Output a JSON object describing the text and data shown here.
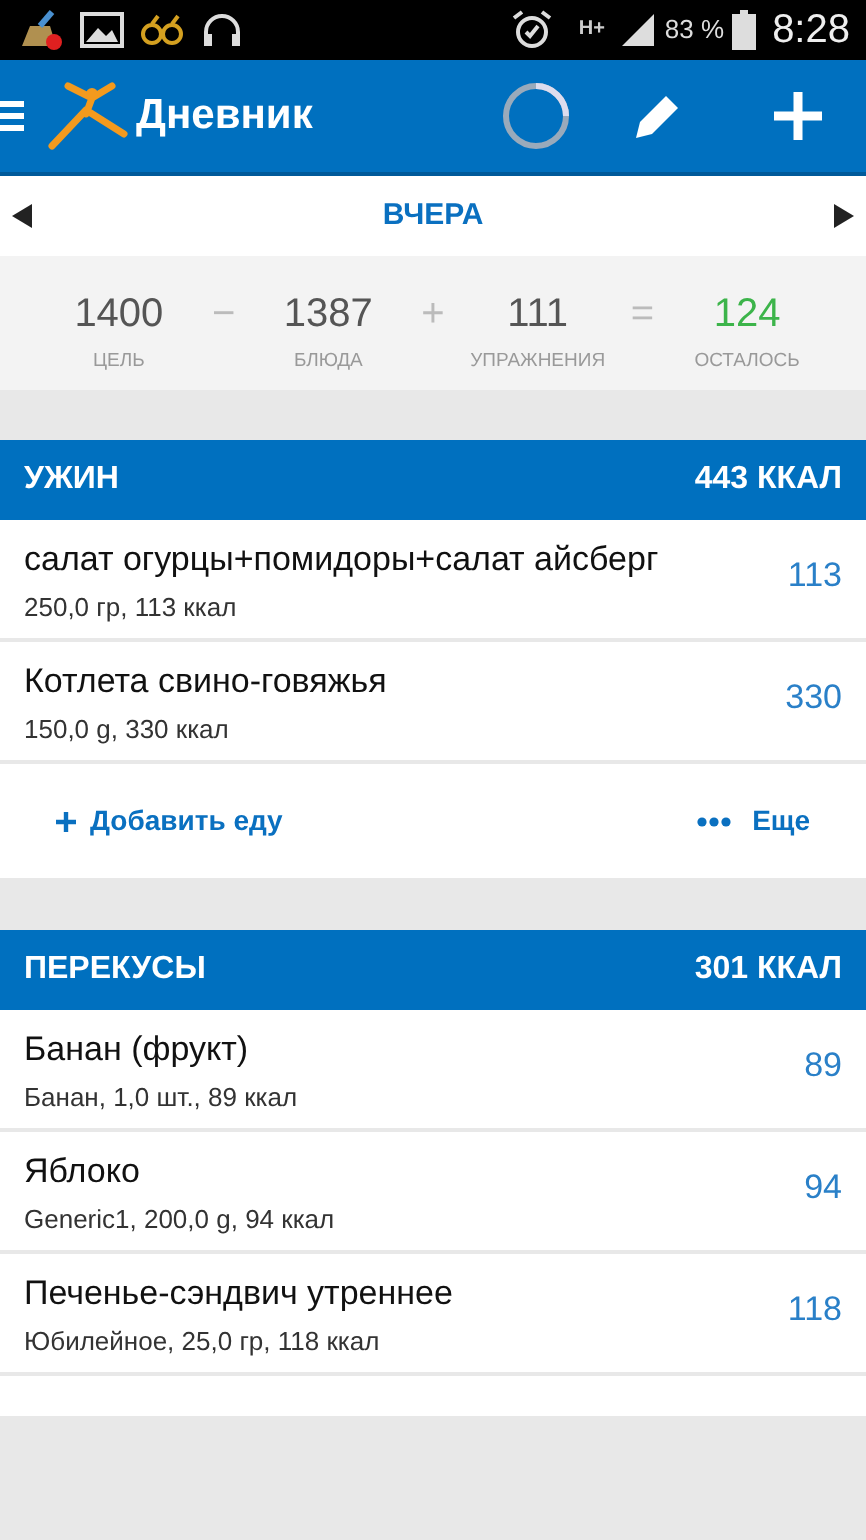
{
  "status_bar": {
    "network": "H+",
    "battery": "83 %",
    "time": "8:28"
  },
  "app_bar": {
    "title": "Дневник"
  },
  "date_nav": {
    "label": "ВЧЕРА"
  },
  "summary": [
    {
      "value": "1400",
      "label": "ЦЕЛЬ",
      "op": "−",
      "kind": "plain"
    },
    {
      "value": "1387",
      "label": "БЛЮДА",
      "op": "+",
      "kind": "plain"
    },
    {
      "value": "111",
      "label": "УПРАЖНЕНИЯ",
      "op": "=",
      "kind": "plain"
    },
    {
      "value": "124",
      "label": "ОСТАЛОСЬ",
      "kind": "result"
    }
  ],
  "sections": [
    {
      "title": "УЖИН",
      "total": "443 ККАЛ",
      "items": [
        {
          "name": "салат огурцы+помидоры+салат айсберг",
          "detail": "250,0 гр, 113 ккал",
          "calories": "113"
        },
        {
          "name": "Котлета свино-говяжья",
          "detail": "150,0 g, 330 ккал",
          "calories": "330"
        }
      ],
      "actions": {
        "add": "Добавить еду",
        "more": "Еще"
      }
    },
    {
      "title": "ПЕРЕКУСЫ",
      "total": "301 ККАЛ",
      "items": [
        {
          "name": "Банан (фрукт)",
          "detail": "Банан, 1,0 шт., 89 ккал",
          "calories": "89"
        },
        {
          "name": "Яблоко",
          "detail": "Generic1, 200,0 g, 94 ккал",
          "calories": "94"
        },
        {
          "name": "Печенье-сэндвич утреннее",
          "detail": "Юбилейное, 25,0 гр, 118 ккал",
          "calories": "118"
        }
      ]
    }
  ]
}
